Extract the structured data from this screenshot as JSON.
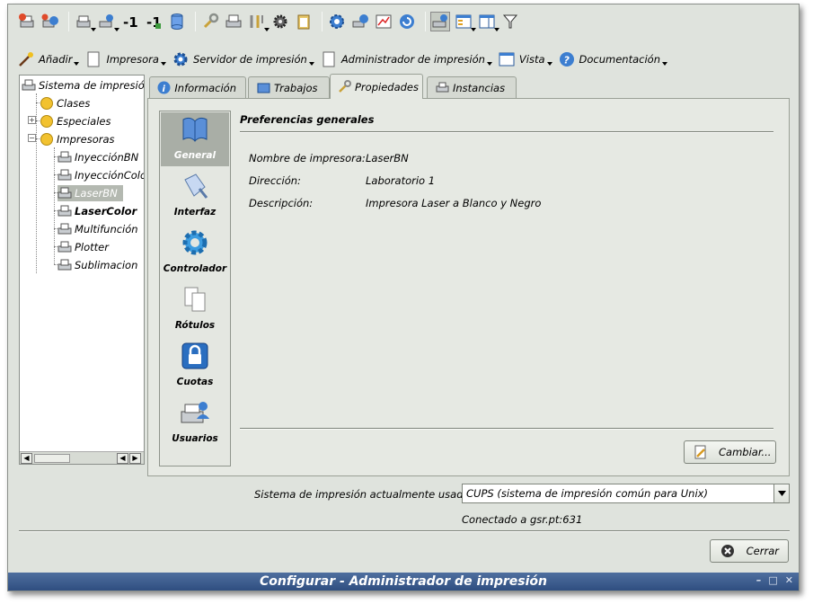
{
  "window": {
    "title": "Configurar - Administrador de impresión",
    "controls": [
      "–",
      "□",
      "✕"
    ]
  },
  "toolbar": {
    "icons": [
      "add-printer-icon",
      "add-class-icon",
      "sep",
      "printer-stop-icon",
      "printer-user-icon",
      "minus-one-icon",
      "minus-one-alt-icon",
      "cylinder-icon",
      "sep",
      "wrench-icon",
      "printer-test-icon",
      "tools-icon",
      "gear-chip-icon",
      "clipboard-icon",
      "sep",
      "server-config-icon",
      "server-settings-icon",
      "graph-icon",
      "refresh-icon",
      "sep",
      "printer-view-icon",
      "window-list-icon",
      "window-icon",
      "filter-icon"
    ]
  },
  "menubar": [
    {
      "label": "Añadir",
      "icon": "magic-wand-icon"
    },
    {
      "label": "Impresora",
      "icon": "document-icon"
    },
    {
      "label": "Servidor de impresión",
      "icon": "gear-icon"
    },
    {
      "label": "Administrador de impresión",
      "icon": "document-icon"
    },
    {
      "label": "Vista",
      "icon": "window-icon"
    },
    {
      "label": "Documentación",
      "icon": "help-icon"
    }
  ],
  "tree": {
    "root": "Sistema de impresión",
    "clases": "Clases",
    "especiales": "Especiales",
    "impresoras": "Impresoras",
    "printers": [
      "InyecciónBN",
      "InyecciónColor",
      "LaserBN",
      "LaserColor",
      "Multifunción",
      "Plotter",
      "Sublimacion"
    ],
    "selected": "LaserBN",
    "bold": "LaserColor"
  },
  "tabs": [
    {
      "label": "Información",
      "icon": "info-icon"
    },
    {
      "label": "Trabajos",
      "icon": "folder-icon"
    },
    {
      "label": "Propiedades",
      "icon": "wrench-icon"
    },
    {
      "label": "Instancias",
      "icon": "printer-icon"
    }
  ],
  "active_tab": "Propiedades",
  "sidenav": [
    {
      "label": "General",
      "icon": "book-icon"
    },
    {
      "label": "Interfaz",
      "icon": "interface-icon"
    },
    {
      "label": "Controlador",
      "icon": "gear-icon"
    },
    {
      "label": "Rótulos",
      "icon": "pages-icon"
    },
    {
      "label": "Cuotas",
      "icon": "lock-icon"
    },
    {
      "label": "Usuarios",
      "icon": "users-icon"
    }
  ],
  "properties": {
    "heading": "Preferencias generales",
    "name_label": "Nombre de impresora:",
    "name_value": "LaserBN",
    "location_label": "Dirección:",
    "location_value": "Laboratorio 1",
    "description_label": "Descripción:",
    "description_value": "Impresora Laser a Blanco y Negro",
    "change_button": "Cambiar..."
  },
  "footer": {
    "system_label": "Sistema de impresión actualmente usado:",
    "system_value": "CUPS (sistema de impresión común para Unix)",
    "connection": "Conectado a gsr.pt:631",
    "close_button": "Cerrar"
  },
  "colors": {
    "window_bg": "#dfe3dd",
    "titlebar": "#3a5a8c",
    "selection": "#a9aea6"
  }
}
